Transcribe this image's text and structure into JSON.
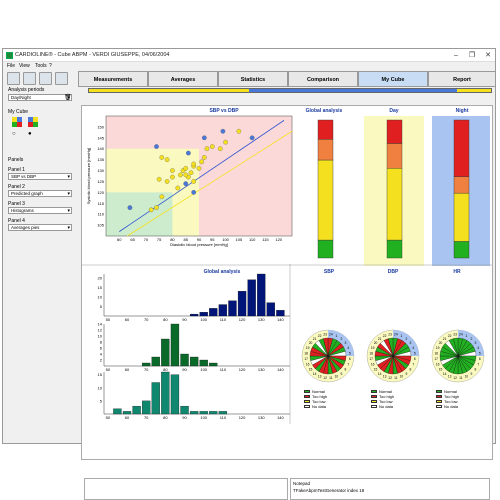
{
  "window": {
    "title": "CARDIOLINE® - Cube ABPM - VERDI GIUSEPPE, 04/06/2004"
  },
  "menu": [
    "File",
    "View",
    "Tools",
    "?"
  ],
  "tabs": [
    {
      "label": "Measurements",
      "active": false
    },
    {
      "label": "Averages",
      "active": false
    },
    {
      "label": "Statistics",
      "active": false
    },
    {
      "label": "Comparison",
      "active": false
    },
    {
      "label": "My Cube",
      "active": true
    },
    {
      "label": "Report",
      "active": false
    }
  ],
  "left": {
    "analysis_periods_label": "Analysis periods",
    "analysis_periods_value": "Day/Night",
    "my_cube_label": "My Cube",
    "panels_label": "Panels",
    "panel1_label": "Panel 1",
    "panel1_value": "SBP vs DBP",
    "panel2_label": "Panel 2",
    "panel2_value": "Predicted graph",
    "panel3_label": "Panel 3",
    "panel3_value": "Histograms",
    "panel4_label": "Panel 4",
    "panel4_value": "Averages pies"
  },
  "colors": {
    "yellow": "#f5e020",
    "blue": "#4a78d8",
    "red": "#e02020",
    "orange": "#f08040",
    "green": "#20b020",
    "navy": "#00157a",
    "darkgreen": "#0a6a2a",
    "teal": "#108870"
  },
  "panels": {
    "scatter_title": "SBP vs DBP",
    "global_analysis": "Global analysis",
    "day": "Day",
    "night": "Night",
    "sbp": "SBP",
    "dbp": "DBP",
    "hr": "HR"
  },
  "legend": {
    "normal": "Normal",
    "too_high": "Too high",
    "too_low": "Too low",
    "no_data": "No data"
  },
  "notepad": {
    "label": "Notepad",
    "text": "TFakeAbpmTestGenerator index 18"
  },
  "chart_data": [
    {
      "type": "scatter",
      "title": "SBP vs DBP",
      "xlabel": "Diastolic blood pressure [mmHg]",
      "ylabel": "Systolic blood pressure [mmHg]",
      "xlim": [
        55,
        125
      ],
      "ylim": [
        100,
        155
      ],
      "xticks": [
        60,
        65,
        70,
        75,
        80,
        85,
        90,
        95,
        100,
        105,
        110,
        115,
        120
      ],
      "yticks": [
        105,
        110,
        115,
        120,
        125,
        130,
        135,
        140,
        145,
        150
      ],
      "series": [
        {
          "color": "#f5e020",
          "x": [
            72,
            74,
            75,
            76,
            78,
            80,
            82,
            83,
            84,
            85,
            86,
            87,
            88,
            88,
            90,
            91,
            92,
            93,
            95,
            98,
            100,
            105,
            78,
            80,
            85,
            88,
            76
          ],
          "y": [
            112,
            113,
            126,
            136,
            135,
            127,
            122,
            128,
            130,
            131,
            127,
            129,
            125,
            132,
            131,
            134,
            136,
            140,
            141,
            140,
            143,
            148,
            125,
            130,
            128,
            133,
            118
          ]
        },
        {
          "color": "#4a78d8",
          "x": [
            64,
            74,
            86,
            92,
            99,
            110,
            85,
            88
          ],
          "y": [
            113,
            141,
            138,
            145,
            148,
            145,
            124,
            120
          ]
        }
      ]
    },
    {
      "type": "bar",
      "title": "Global analysis",
      "categories": [
        "Day",
        "Night"
      ],
      "series": [
        {
          "name": "Day",
          "segments": [
            {
              "color": "#20b020",
              "value": 13
            },
            {
              "color": "#f5e020",
              "value": 52
            },
            {
              "color": "#f08040",
              "value": 18
            },
            {
              "color": "#e02020",
              "value": 17
            }
          ]
        },
        {
          "name": "Night",
          "segments": [
            {
              "color": "#20b020",
              "value": 12
            },
            {
              "color": "#f5e020",
              "value": 35
            },
            {
              "color": "#f08040",
              "value": 12
            },
            {
              "color": "#e02020",
              "value": 41
            }
          ]
        }
      ]
    },
    {
      "type": "bar",
      "title": "Global analysis",
      "xticks": [
        50,
        60,
        70,
        80,
        90,
        100,
        110,
        120,
        130,
        140
      ],
      "series": [
        {
          "color": "#00157a",
          "yticks": [
            5,
            10,
            15,
            20
          ],
          "values": [
            [
              95,
              1
            ],
            [
              100,
              2
            ],
            [
              105,
              4
            ],
            [
              110,
              6
            ],
            [
              115,
              8
            ],
            [
              120,
              13
            ],
            [
              125,
              19
            ],
            [
              130,
              22
            ],
            [
              135,
              7
            ],
            [
              140,
              3
            ]
          ]
        },
        {
          "color": "#0a6a2a",
          "yticks": [
            2,
            4,
            6,
            8,
            10,
            12,
            14
          ],
          "values": [
            [
              70,
              1
            ],
            [
              75,
              3
            ],
            [
              80,
              9
            ],
            [
              85,
              14
            ],
            [
              90,
              4
            ],
            [
              95,
              3
            ],
            [
              100,
              2
            ],
            [
              105,
              1
            ]
          ]
        },
        {
          "color": "#108870",
          "yticks": [
            5,
            10,
            15
          ],
          "values": [
            [
              55,
              2
            ],
            [
              60,
              1
            ],
            [
              65,
              3
            ],
            [
              70,
              5
            ],
            [
              75,
              12
            ],
            [
              80,
              16
            ],
            [
              85,
              15
            ],
            [
              90,
              3
            ],
            [
              95,
              1
            ],
            [
              100,
              1
            ],
            [
              105,
              1
            ],
            [
              110,
              1
            ]
          ]
        }
      ]
    },
    {
      "type": "pie",
      "charts": [
        "SBP",
        "DBP",
        "HR"
      ],
      "hours": [
        24,
        1,
        2,
        3,
        4,
        5,
        6,
        7,
        8,
        9,
        10,
        11,
        12,
        13,
        14,
        15,
        16,
        17,
        18,
        19,
        20,
        21,
        22,
        23
      ]
    }
  ]
}
